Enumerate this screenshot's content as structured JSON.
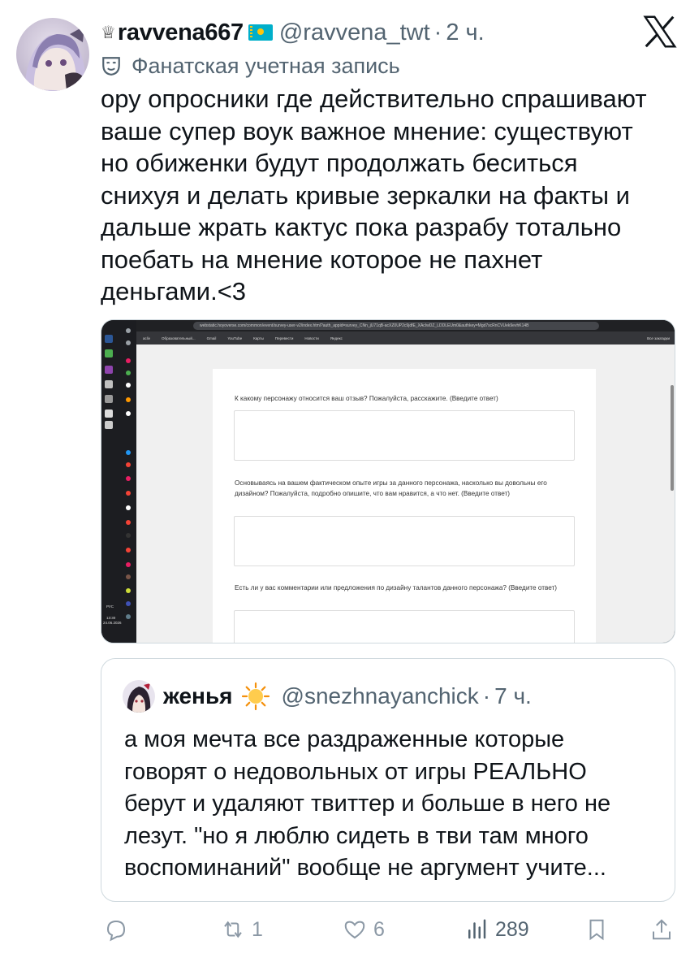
{
  "tweet": {
    "display_name": "ravvena667",
    "handle": "@ravvena_twt",
    "time": "2 ч.",
    "fan_label": "Фанатская учетная запись",
    "text": "ору опросники где действительно спрашивают\nваше супер воук важное мнение: существуют\nно обиженки будут продолжать беситься\nснихуя и делать кривые зеркалки на факты и\nдальше жрать кактус пока разрабу тотально\nпоебать на мнение которое не пахнет\nденьгами.<3"
  },
  "screenshot": {
    "url": "webstatic.hoyoverse.com/common/event/survey-user-v2/index.html?auth_appid=survey_CNn_jU71qB-acXZ0UP2c9jdfE_XAcIwDZ_LDDLEUm0&authkey=Mgd7scRnCVUek9evhK14B",
    "bookmarks": [
      "acliv",
      "Образовательный...",
      "Gmail",
      "YouTube",
      "Карты",
      "Перевести",
      "Новости",
      "Яндекс"
    ],
    "all_bookmarks": "Все закладки",
    "taskbar_lang": "РУС",
    "taskbar_time": "13:30",
    "taskbar_date": "24.06.2026",
    "questions": [
      "К какому персонажу относится ваш отзыв? Пожалуйста, расскажите.  (Введите ответ)",
      "Основываясь на вашем фактическом опыте игры за данного персонажа, насколько вы довольны его дизайном? Пожалуйста, подробно опишите, что вам нравится, а что нет. (Введите ответ)",
      "Есть ли у вас комментарии или предложения по дизайну талантов данного персонажа? (Введите ответ)"
    ]
  },
  "quote": {
    "display_name": "женья",
    "handle": "@snezhnayanchick",
    "time": "7 ч.",
    "text": "а моя мечта все раздраженные которые\nговорят о недовольных от игры РЕАЛЬНО\nберут и удаляют твиттер и больше в него не\nлезут. \"но я люблю сидеть в тви там много\nвоспоминаний\" вообще не аргумент учите..."
  },
  "actions": {
    "reply_icon": "reply-icon",
    "retweet_count": "1",
    "like_count": "6",
    "views_count": "289",
    "bookmark_icon": "bookmark-icon",
    "share_icon": "share-icon"
  },
  "colors": {
    "text": "#0f1419",
    "secondary": "#536471",
    "border": "#cfd9de"
  }
}
